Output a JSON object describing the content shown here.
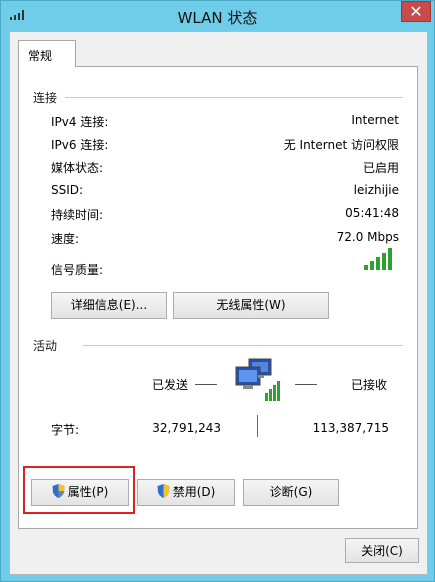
{
  "window": {
    "title": "WLAN 状态",
    "close_glyph": "✕"
  },
  "tabs": [
    {
      "label": "常规"
    }
  ],
  "connection": {
    "section_title": "连接",
    "rows": [
      {
        "label": "IPv4 连接:",
        "value": "Internet"
      },
      {
        "label": "IPv6 连接:",
        "value": "无 Internet 访问权限"
      },
      {
        "label": "媒体状态:",
        "value": "已启用"
      },
      {
        "label": "SSID:",
        "value": "leizhijie"
      },
      {
        "label": "持续时间:",
        "value": "05:41:48"
      },
      {
        "label": "速度:",
        "value": "72.0 Mbps"
      }
    ],
    "signal_label": "信号质量:",
    "signal_bars": 5,
    "details_button": "详细信息(E)...",
    "wireless_props_button": "无线属性(W)"
  },
  "activity": {
    "section_title": "活动",
    "sent_label": "已发送",
    "received_label": "已接收",
    "bytes_label": "字节:",
    "bytes_sent": "32,791,243",
    "bytes_received": "113,387,715"
  },
  "actions": {
    "properties_button": "属性(P)",
    "disable_button": "禁用(D)",
    "diagnose_button": "诊断(G)",
    "close_button": "关闭(C)"
  },
  "colors": {
    "accent": "#d22222",
    "signal": "#2ea12e",
    "frame": "#6fcde9"
  }
}
